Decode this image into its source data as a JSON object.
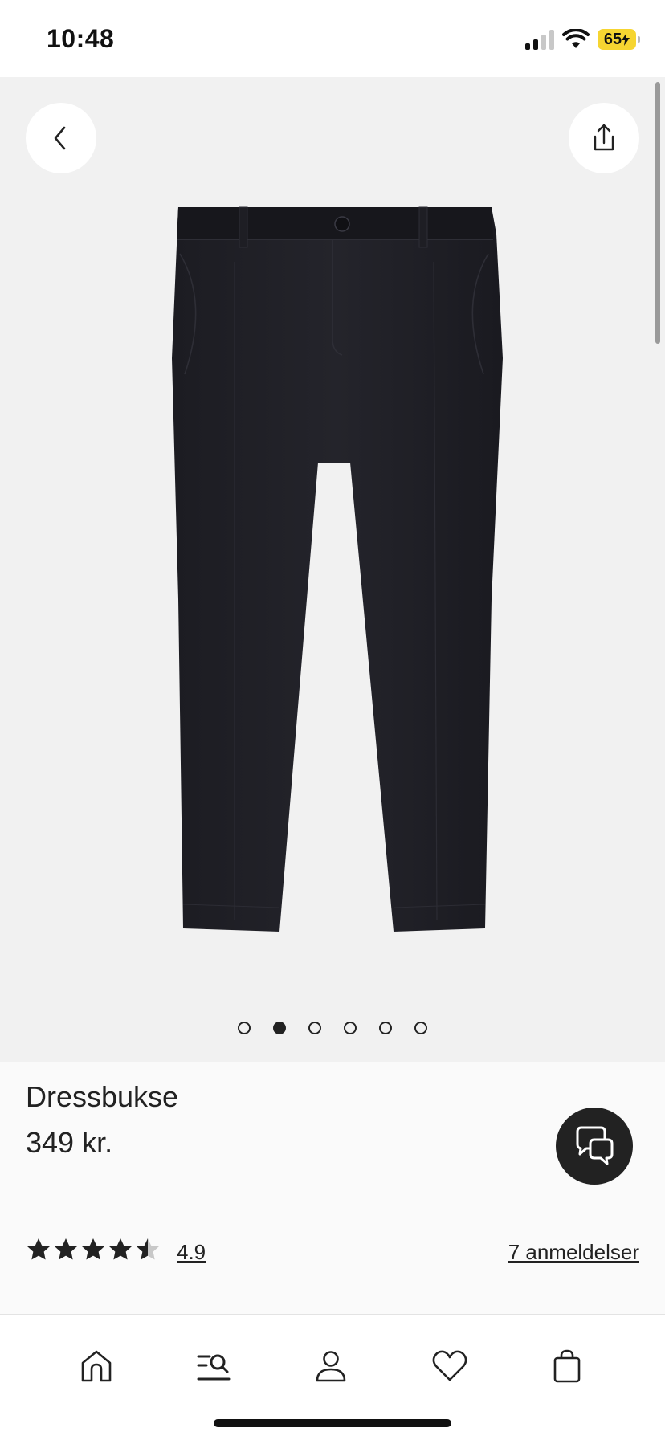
{
  "status_bar": {
    "time": "10:48",
    "battery": "65"
  },
  "gallery": {
    "image_count": 6,
    "active_index": 1,
    "back_icon": "chevron-left-icon",
    "share_icon": "share-icon"
  },
  "product": {
    "title": "Dressbukse",
    "price": "349 kr."
  },
  "rating": {
    "value": "4.9",
    "stars": 4.9,
    "reviews_link": "7 anmeldelser"
  },
  "bottom_nav": {
    "items": [
      {
        "icon": "home-icon"
      },
      {
        "icon": "search-icon"
      },
      {
        "icon": "account-icon"
      },
      {
        "icon": "heart-icon"
      },
      {
        "icon": "bag-icon"
      }
    ]
  },
  "colors": {
    "accent": "#222222",
    "battery": "#f6d531",
    "gallery_bg": "#f1f1f1"
  }
}
